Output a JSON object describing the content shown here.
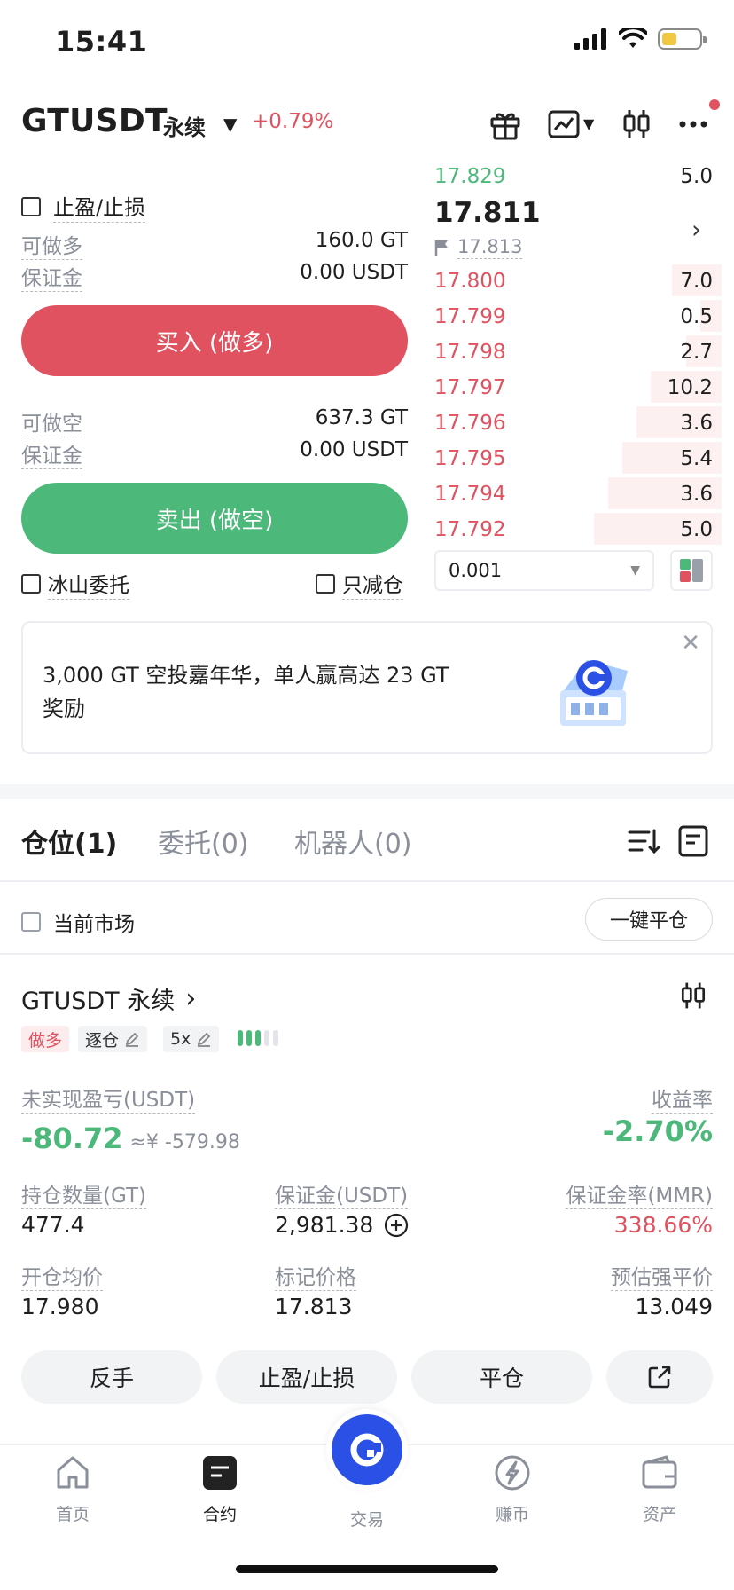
{
  "status_bar": {
    "time": "15:41"
  },
  "header": {
    "pair": "GTUSDT",
    "type": "永续",
    "change": "+0.79%"
  },
  "trade": {
    "tp_sl_label": "止盈/止损",
    "long": {
      "avail_label": "可做多",
      "avail_value": "160.0 GT",
      "margin_label": "保证金",
      "margin_value": "0.00 USDT"
    },
    "buy_button": "买入 (做多)",
    "short": {
      "avail_label": "可做空",
      "avail_value": "637.3 GT",
      "margin_label": "保证金",
      "margin_value": "0.00 USDT"
    },
    "sell_button": "卖出 (做空)",
    "iceberg_label": "冰山委托",
    "reduce_only_label": "只减仓"
  },
  "orderbook": {
    "top_row": {
      "price": "17.829",
      "size": "5.0"
    },
    "last_price": "17.811",
    "mark_price": "17.813",
    "asks": [
      {
        "price": "17.800",
        "size": "7.0",
        "depth": 0.28
      },
      {
        "price": "17.799",
        "size": "0.5",
        "depth": 0.12
      },
      {
        "price": "17.798",
        "size": "2.7",
        "depth": 0.2
      },
      {
        "price": "17.797",
        "size": "10.2",
        "depth": 0.4
      },
      {
        "price": "17.796",
        "size": "3.6",
        "depth": 0.48
      },
      {
        "price": "17.795",
        "size": "5.4",
        "depth": 0.56
      },
      {
        "price": "17.794",
        "size": "3.6",
        "depth": 0.64
      },
      {
        "price": "17.792",
        "size": "5.0",
        "depth": 0.72
      }
    ],
    "precision": "0.001"
  },
  "promo": {
    "line1": "3,000 GT 空投嘉年华，单人赢高达 23 GT",
    "line2": "奖励"
  },
  "tabs": {
    "positions": "仓位(1)",
    "orders": "委托(0)",
    "bots": "机器人(0)"
  },
  "filter": {
    "current_market": "当前市场",
    "close_all": "一键平仓"
  },
  "position": {
    "title": "GTUSDT 永续",
    "side_tag": "做多",
    "margin_mode": "逐仓",
    "leverage": "5x",
    "pnl_label": "未实现盈亏(USDT)",
    "pnl_value": "-80.72",
    "pnl_cny": "≈¥ -579.98",
    "roe_label": "收益率",
    "roe_value": "-2.70%",
    "size_label": "持仓数量(GT)",
    "size_value": "477.4",
    "margin_label": "保证金(USDT)",
    "margin_value": "2,981.38",
    "mmr_label": "保证金率(MMR)",
    "mmr_value": "338.66%",
    "entry_label": "开仓均价",
    "entry_value": "17.980",
    "mark_label": "标记价格",
    "mark_value": "17.813",
    "liq_label": "预估强平价",
    "liq_value": "13.049",
    "buttons": {
      "reverse": "反手",
      "tp_sl": "止盈/止损",
      "close": "平仓"
    }
  },
  "bottom_nav": {
    "home": "首页",
    "futures": "合约",
    "trade": "交易",
    "earn": "赚币",
    "assets": "资产"
  },
  "colors": {
    "buy": "#e0525f",
    "sell": "#4cb87a",
    "brand": "#2a50e6"
  }
}
